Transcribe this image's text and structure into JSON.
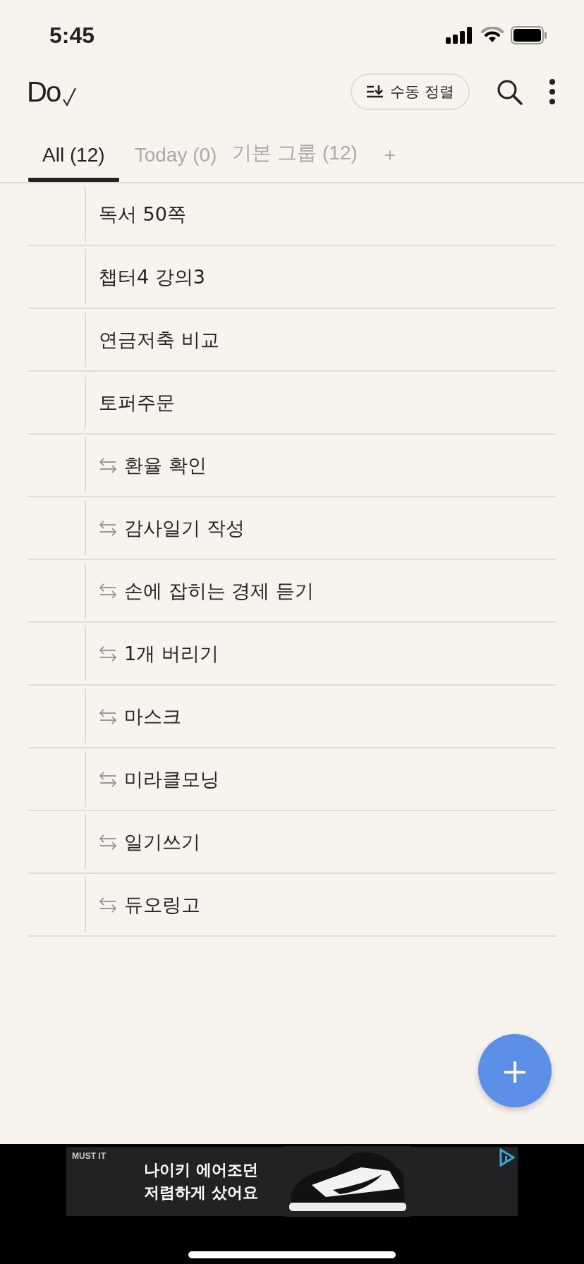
{
  "status_bar": {
    "time": "5:45"
  },
  "header": {
    "logo": "Do",
    "sort_button": "수동 정렬"
  },
  "tabs": [
    {
      "label": "All (12)",
      "selected": true
    },
    {
      "label": "Today (0)",
      "selected": false
    },
    {
      "label": "기본 그룹 (12)",
      "selected": false
    }
  ],
  "add_tab": "+",
  "tasks": [
    {
      "title": "독서 50쪽",
      "repeat": false
    },
    {
      "title": "챕터4 강의3",
      "repeat": false
    },
    {
      "title": "연금저축 비교",
      "repeat": false
    },
    {
      "title": "토퍼주문",
      "repeat": false
    },
    {
      "title": "환율 확인",
      "repeat": true
    },
    {
      "title": "감사일기 작성",
      "repeat": true
    },
    {
      "title": "손에 잡히는 경제 듣기",
      "repeat": true
    },
    {
      "title": "1개 버리기",
      "repeat": true
    },
    {
      "title": "마스크",
      "repeat": true
    },
    {
      "title": "미라클모닝",
      "repeat": true
    },
    {
      "title": "일기쓰기",
      "repeat": true
    },
    {
      "title": "듀오링고",
      "repeat": true
    }
  ],
  "fab": "+",
  "ad": {
    "brand": "MUST IT",
    "line_1": "나이키 에어조던",
    "line_2": "저렴하게 샀어요"
  }
}
